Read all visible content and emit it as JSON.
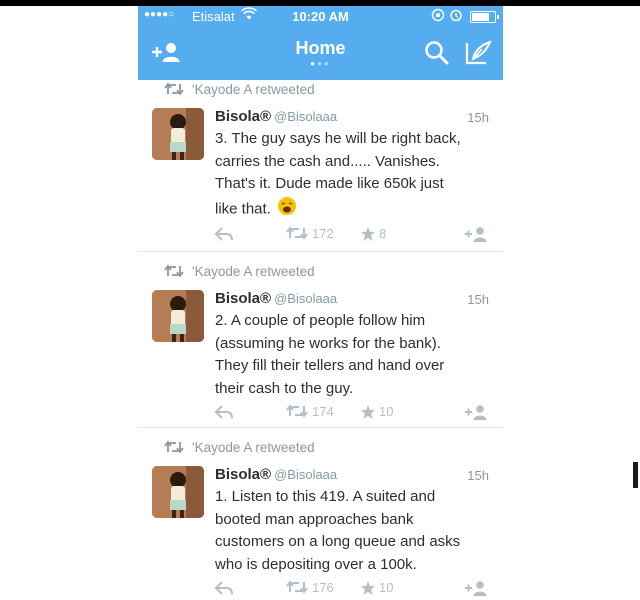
{
  "status_bar": {
    "signal": "●●●●○",
    "carrier": "Etisalat",
    "time": "10:20 AM"
  },
  "nav": {
    "title": "Home",
    "icons": [
      "add-user-icon",
      "search-icon",
      "compose-icon"
    ]
  },
  "colors": {
    "brand": "#55acee",
    "secondary_text": "#8899a6",
    "action_icon": "#b4c0c8"
  },
  "tweets": [
    {
      "retweeted_by": "'Kayode A retweeted",
      "name": "Bisola®",
      "handle": "@Bisolaaa",
      "time": "15h",
      "text_lines": [
        "3. The guy says he will be right back,",
        "carries the cash and..... Vanishes.",
        "That's it. Dude made like 650k just",
        "like that."
      ],
      "emoji": "weary-face-emoji",
      "retweets": "172",
      "favorites": "8"
    },
    {
      "retweeted_by": "'Kayode A retweeted",
      "name": "Bisola®",
      "handle": "@Bisolaaa",
      "time": "15h",
      "text_lines": [
        "2. A couple of people follow him",
        "(assuming  he works for the bank).",
        "They fill their tellers and hand over",
        "their cash to the guy."
      ],
      "retweets": "174",
      "favorites": "10"
    },
    {
      "retweeted_by": "'Kayode A retweeted",
      "name": "Bisola®",
      "handle": "@Bisolaaa",
      "time": "15h",
      "text_lines": [
        "1. Listen to this 419. A suited and",
        "booted man approaches bank",
        "customers on a long queue and asks",
        "who is depositing over a 100k."
      ],
      "retweets": "176",
      "favorites": "10"
    }
  ]
}
